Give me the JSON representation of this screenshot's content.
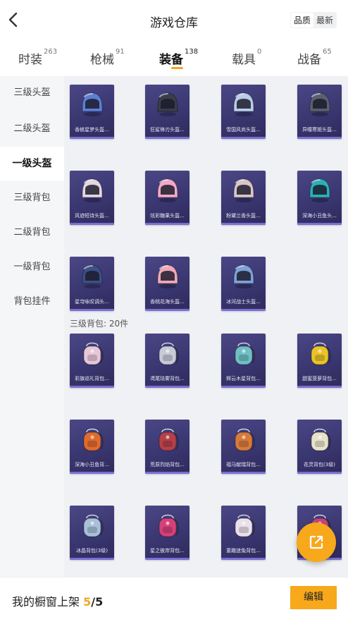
{
  "header": {
    "title": "游戏仓库",
    "sort_options": [
      "品质",
      "最新"
    ],
    "active_sort": "品质"
  },
  "tabs": [
    {
      "label": "时装",
      "count": "263"
    },
    {
      "label": "枪械",
      "count": "91"
    },
    {
      "label": "装备",
      "count": "138"
    },
    {
      "label": "载具",
      "count": "0"
    },
    {
      "label": "战备",
      "count": "65"
    }
  ],
  "active_tab": "装备",
  "sidebar": {
    "items": [
      "三级头盔",
      "二级头盔",
      "一级头盔",
      "三级背包",
      "二级背包",
      "一级背包",
      "背包挂件"
    ],
    "active": "一级头盔"
  },
  "helmets": [
    {
      "label": "香槟星梦头盔...",
      "icon": "helmet-icon",
      "color": "#5c7fd6"
    },
    {
      "label": "狂鲨锋刃头盔...",
      "icon": "helmet-icon",
      "color": "#3a3d4a"
    },
    {
      "label": "雪国风尚头盔...",
      "icon": "helmet-icon",
      "color": "#b9cde8"
    },
    {
      "label": "异瞳寒姬头盔...",
      "icon": "helmet-icon",
      "color": "#5a6070"
    },
    {
      "label": "风迹短诗头盔...",
      "icon": "helmet-icon",
      "color": "#e3d7e0"
    },
    {
      "label": "炫彩糖果头盔...",
      "icon": "helmet-icon",
      "color": "#f1a9c8"
    },
    {
      "label": "粉黛兰香头盔...",
      "icon": "helmet-icon",
      "color": "#d9c7c8"
    },
    {
      "label": "深海小丑鱼头...",
      "icon": "helmet-icon",
      "color": "#2bb0b6"
    },
    {
      "label": "星穹咏叹调头...",
      "icon": "helmet-icon",
      "color": "#3c4f86"
    },
    {
      "label": "香桃花海头盔...",
      "icon": "helmet-icon",
      "color": "#f0a8b8"
    },
    {
      "label": "冰河战士头盔...",
      "icon": "helmet-icon",
      "color": "#7da2d8"
    }
  ],
  "backpack_section": {
    "title": "三级背包: 20件"
  },
  "backpacks": [
    {
      "label": "彩旗巡礼背包...",
      "icon": "backpack-icon",
      "color": "#e6c7d8"
    },
    {
      "label": "鸢尾珐雾背包...",
      "icon": "backpack-icon",
      "color": "#c7c9d6"
    },
    {
      "label": "辉云木星背包...",
      "icon": "backpack-icon",
      "color": "#6fbfc4"
    },
    {
      "label": "甜蜜菠萝背包...",
      "icon": "backpack-icon",
      "color": "#e8c427"
    },
    {
      "label": "深海小丑鱼背...",
      "icon": "backpack-icon",
      "color": "#e06b2e"
    },
    {
      "label": "荒原烈焰背包...",
      "icon": "backpack-icon",
      "color": "#b5404a"
    },
    {
      "label": "福马献瑞背包...",
      "icon": "backpack-icon",
      "color": "#d77a3a"
    },
    {
      "label": "花灵背包(3级)",
      "icon": "backpack-icon",
      "color": "#e7e2c8"
    },
    {
      "label": "冰晶背包(3级)",
      "icon": "backpack-icon",
      "color": "#a8c0d8"
    },
    {
      "label": "星之彼岸背包...",
      "icon": "backpack-icon",
      "color": "#d6407a"
    },
    {
      "label": "童趣迷兔背包...",
      "icon": "backpack-icon",
      "color": "#e9e0ea"
    },
    {
      "label": "",
      "icon": "backpack-icon",
      "color": "#c4457a"
    }
  ],
  "footer": {
    "text": "我的橱窗上架",
    "current": "5",
    "total": "/5",
    "edit_label": "编辑"
  },
  "colors": {
    "accent": "#f7a81b",
    "card_bg": "#3a3670"
  }
}
